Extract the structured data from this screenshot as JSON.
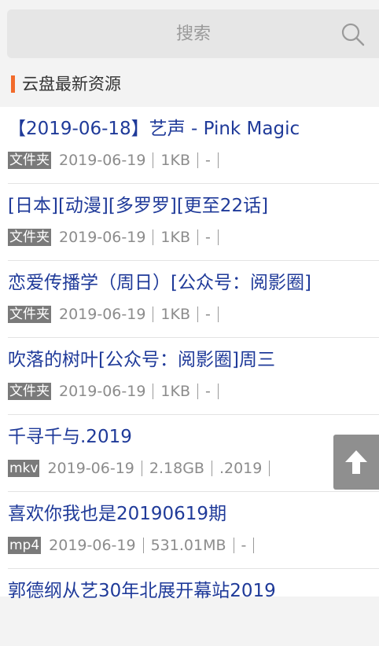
{
  "search": {
    "placeholder": "搜索",
    "icon": "search-icon"
  },
  "section": {
    "title": "云盘最新资源",
    "accent_color": "#f26b2b"
  },
  "items": [
    {
      "title": "【2019-06-18】艺声 - Pink Magic",
      "type": "文件夹",
      "date": "2019-06-19",
      "size": "1KB",
      "ext": "-"
    },
    {
      "title": "[日本][动漫][多罗罗][更至22话]",
      "type": "文件夹",
      "date": "2019-06-19",
      "size": "1KB",
      "ext": "-"
    },
    {
      "title": "恋爱传播学（周日）[公众号：阅影圈]",
      "type": "文件夹",
      "date": "2019-06-19",
      "size": "1KB",
      "ext": "-"
    },
    {
      "title": "吹落的树叶[公众号：阅影圈]周三",
      "type": "文件夹",
      "date": "2019-06-19",
      "size": "1KB",
      "ext": "-"
    },
    {
      "title": "千寻千与.2019",
      "type": "mkv",
      "date": "2019-06-19",
      "size": "2.18GB",
      "ext": ".2019"
    },
    {
      "title": "喜欢你我也是20190619期",
      "type": "mp4",
      "date": "2019-06-19",
      "size": "531.01MB",
      "ext": "-"
    },
    {
      "title": "郭德纲从艺30年北展开幕站2019",
      "type": "",
      "date": "",
      "size": "",
      "ext": ""
    }
  ],
  "back_to_top": {
    "icon": "arrow-up-icon"
  },
  "colors": {
    "title_link": "#1f3a99",
    "badge_bg": "#7a7a7a",
    "meta_text": "#8c8c8c"
  }
}
